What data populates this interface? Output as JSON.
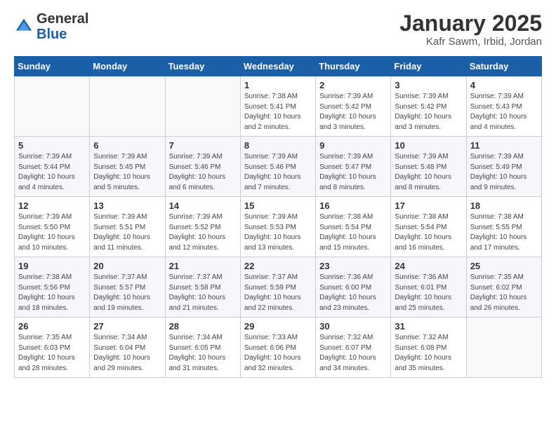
{
  "header": {
    "logo_general": "General",
    "logo_blue": "Blue",
    "month_title": "January 2025",
    "location": "Kafr Sawm, Irbid, Jordan"
  },
  "days_of_week": [
    "Sunday",
    "Monday",
    "Tuesday",
    "Wednesday",
    "Thursday",
    "Friday",
    "Saturday"
  ],
  "weeks": [
    [
      {
        "day": "",
        "info": ""
      },
      {
        "day": "",
        "info": ""
      },
      {
        "day": "",
        "info": ""
      },
      {
        "day": "1",
        "info": "Sunrise: 7:38 AM\nSunset: 5:41 PM\nDaylight: 10 hours\nand 2 minutes."
      },
      {
        "day": "2",
        "info": "Sunrise: 7:39 AM\nSunset: 5:42 PM\nDaylight: 10 hours\nand 3 minutes."
      },
      {
        "day": "3",
        "info": "Sunrise: 7:39 AM\nSunset: 5:42 PM\nDaylight: 10 hours\nand 3 minutes."
      },
      {
        "day": "4",
        "info": "Sunrise: 7:39 AM\nSunset: 5:43 PM\nDaylight: 10 hours\nand 4 minutes."
      }
    ],
    [
      {
        "day": "5",
        "info": "Sunrise: 7:39 AM\nSunset: 5:44 PM\nDaylight: 10 hours\nand 4 minutes."
      },
      {
        "day": "6",
        "info": "Sunrise: 7:39 AM\nSunset: 5:45 PM\nDaylight: 10 hours\nand 5 minutes."
      },
      {
        "day": "7",
        "info": "Sunrise: 7:39 AM\nSunset: 5:46 PM\nDaylight: 10 hours\nand 6 minutes."
      },
      {
        "day": "8",
        "info": "Sunrise: 7:39 AM\nSunset: 5:46 PM\nDaylight: 10 hours\nand 7 minutes."
      },
      {
        "day": "9",
        "info": "Sunrise: 7:39 AM\nSunset: 5:47 PM\nDaylight: 10 hours\nand 8 minutes."
      },
      {
        "day": "10",
        "info": "Sunrise: 7:39 AM\nSunset: 5:48 PM\nDaylight: 10 hours\nand 8 minutes."
      },
      {
        "day": "11",
        "info": "Sunrise: 7:39 AM\nSunset: 5:49 PM\nDaylight: 10 hours\nand 9 minutes."
      }
    ],
    [
      {
        "day": "12",
        "info": "Sunrise: 7:39 AM\nSunset: 5:50 PM\nDaylight: 10 hours\nand 10 minutes."
      },
      {
        "day": "13",
        "info": "Sunrise: 7:39 AM\nSunset: 5:51 PM\nDaylight: 10 hours\nand 11 minutes."
      },
      {
        "day": "14",
        "info": "Sunrise: 7:39 AM\nSunset: 5:52 PM\nDaylight: 10 hours\nand 12 minutes."
      },
      {
        "day": "15",
        "info": "Sunrise: 7:39 AM\nSunset: 5:53 PM\nDaylight: 10 hours\nand 13 minutes."
      },
      {
        "day": "16",
        "info": "Sunrise: 7:38 AM\nSunset: 5:54 PM\nDaylight: 10 hours\nand 15 minutes."
      },
      {
        "day": "17",
        "info": "Sunrise: 7:38 AM\nSunset: 5:54 PM\nDaylight: 10 hours\nand 16 minutes."
      },
      {
        "day": "18",
        "info": "Sunrise: 7:38 AM\nSunset: 5:55 PM\nDaylight: 10 hours\nand 17 minutes."
      }
    ],
    [
      {
        "day": "19",
        "info": "Sunrise: 7:38 AM\nSunset: 5:56 PM\nDaylight: 10 hours\nand 18 minutes."
      },
      {
        "day": "20",
        "info": "Sunrise: 7:37 AM\nSunset: 5:57 PM\nDaylight: 10 hours\nand 19 minutes."
      },
      {
        "day": "21",
        "info": "Sunrise: 7:37 AM\nSunset: 5:58 PM\nDaylight: 10 hours\nand 21 minutes."
      },
      {
        "day": "22",
        "info": "Sunrise: 7:37 AM\nSunset: 5:59 PM\nDaylight: 10 hours\nand 22 minutes."
      },
      {
        "day": "23",
        "info": "Sunrise: 7:36 AM\nSunset: 6:00 PM\nDaylight: 10 hours\nand 23 minutes."
      },
      {
        "day": "24",
        "info": "Sunrise: 7:36 AM\nSunset: 6:01 PM\nDaylight: 10 hours\nand 25 minutes."
      },
      {
        "day": "25",
        "info": "Sunrise: 7:35 AM\nSunset: 6:02 PM\nDaylight: 10 hours\nand 26 minutes."
      }
    ],
    [
      {
        "day": "26",
        "info": "Sunrise: 7:35 AM\nSunset: 6:03 PM\nDaylight: 10 hours\nand 28 minutes."
      },
      {
        "day": "27",
        "info": "Sunrise: 7:34 AM\nSunset: 6:04 PM\nDaylight: 10 hours\nand 29 minutes."
      },
      {
        "day": "28",
        "info": "Sunrise: 7:34 AM\nSunset: 6:05 PM\nDaylight: 10 hours\nand 31 minutes."
      },
      {
        "day": "29",
        "info": "Sunrise: 7:33 AM\nSunset: 6:06 PM\nDaylight: 10 hours\nand 32 minutes."
      },
      {
        "day": "30",
        "info": "Sunrise: 7:32 AM\nSunset: 6:07 PM\nDaylight: 10 hours\nand 34 minutes."
      },
      {
        "day": "31",
        "info": "Sunrise: 7:32 AM\nSunset: 6:08 PM\nDaylight: 10 hours\nand 35 minutes."
      },
      {
        "day": "",
        "info": ""
      }
    ]
  ]
}
